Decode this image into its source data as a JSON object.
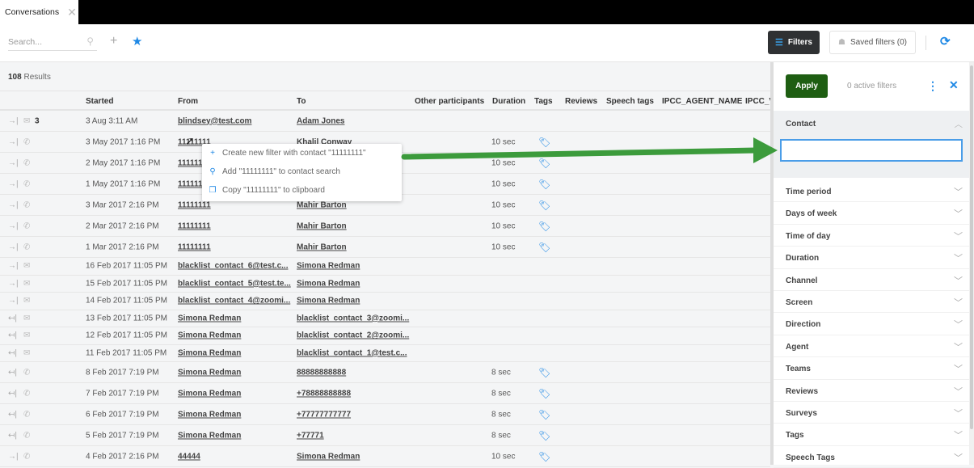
{
  "tab": {
    "title": "Conversations"
  },
  "toolbar": {
    "search_placeholder": "Search...",
    "filters_label": "Filters",
    "saved_filters_label": "Saved filters (0)"
  },
  "results": {
    "count": "108",
    "label": "Results"
  },
  "columns": [
    "Started",
    "From",
    "To",
    "Other participants",
    "Duration",
    "Tags",
    "Reviews",
    "Speech tags",
    "IPCC_AGENT_NAME",
    "IPCC_V"
  ],
  "rows": [
    {
      "dir": "in",
      "channel": "email",
      "count": "3",
      "started": "3 Aug 3:11 AM",
      "from": "blindsey@test.com",
      "to": "Adam Jones",
      "duration": "",
      "tag": false,
      "size": "tall"
    },
    {
      "dir": "in",
      "channel": "phone",
      "count": "",
      "started": "3 May 2017 1:16 PM",
      "from": "11111111",
      "to": "Khalil Conway",
      "duration": "10 sec",
      "tag": true,
      "size": "tall"
    },
    {
      "dir": "in",
      "channel": "phone",
      "count": "",
      "started": "2 May 2017 1:16 PM",
      "from": "11111111",
      "to": "",
      "duration": "10 sec",
      "tag": true,
      "size": "tall"
    },
    {
      "dir": "in",
      "channel": "phone",
      "count": "",
      "started": "1 May 2017 1:16 PM",
      "from": "11111111",
      "to": "",
      "duration": "10 sec",
      "tag": true,
      "size": "tall"
    },
    {
      "dir": "in",
      "channel": "phone",
      "count": "",
      "started": "3 Mar 2017 2:16 PM",
      "from": "11111111",
      "to": "Mahir Barton",
      "duration": "10 sec",
      "tag": true,
      "size": "tall"
    },
    {
      "dir": "in",
      "channel": "phone",
      "count": "",
      "started": "2 Mar 2017 2:16 PM",
      "from": "11111111",
      "to": "Mahir Barton",
      "duration": "10 sec",
      "tag": true,
      "size": "tall"
    },
    {
      "dir": "in",
      "channel": "phone",
      "count": "",
      "started": "1 Mar 2017 2:16 PM",
      "from": "11111111",
      "to": "Mahir Barton",
      "duration": "10 sec",
      "tag": true,
      "size": "tall"
    },
    {
      "dir": "in",
      "channel": "email",
      "count": "",
      "started": "16 Feb 2017 11:05 PM",
      "from": "blacklist_contact_6@test.c...",
      "to": "Simona Redman",
      "duration": "",
      "tag": false,
      "size": "short"
    },
    {
      "dir": "in",
      "channel": "email",
      "count": "",
      "started": "15 Feb 2017 11:05 PM",
      "from": "blacklist_contact_5@test.te...",
      "to": "Simona Redman",
      "duration": "",
      "tag": false,
      "size": "short"
    },
    {
      "dir": "in",
      "channel": "email",
      "count": "",
      "started": "14 Feb 2017 11:05 PM",
      "from": "blacklist_contact_4@zoomi...",
      "to": "Simona Redman",
      "duration": "",
      "tag": false,
      "size": "short"
    },
    {
      "dir": "out",
      "channel": "email",
      "count": "",
      "started": "13 Feb 2017 11:05 PM",
      "from": "Simona Redman",
      "to": "blacklist_contact_3@zoomi...",
      "duration": "",
      "tag": false,
      "size": "short"
    },
    {
      "dir": "out",
      "channel": "email",
      "count": "",
      "started": "12 Feb 2017 11:05 PM",
      "from": "Simona Redman",
      "to": "blacklist_contact_2@zoomi...",
      "duration": "",
      "tag": false,
      "size": "short"
    },
    {
      "dir": "out",
      "channel": "email",
      "count": "",
      "started": "11 Feb 2017 11:05 PM",
      "from": "Simona Redman",
      "to": "blacklist_contact_1@test.c...",
      "duration": "",
      "tag": false,
      "size": "short"
    },
    {
      "dir": "out",
      "channel": "phone",
      "count": "",
      "started": "8 Feb 2017 7:19 PM",
      "from": "Simona Redman",
      "to": "88888888888",
      "duration": "8 sec",
      "tag": true,
      "size": "tall"
    },
    {
      "dir": "out",
      "channel": "phone",
      "count": "",
      "started": "7 Feb 2017 7:19 PM",
      "from": "Simona Redman",
      "to": "+78888888888",
      "duration": "8 sec",
      "tag": true,
      "size": "tall"
    },
    {
      "dir": "out",
      "channel": "phone",
      "count": "",
      "started": "6 Feb 2017 7:19 PM",
      "from": "Simona Redman",
      "to": "+77777777777",
      "duration": "8 sec",
      "tag": true,
      "size": "tall"
    },
    {
      "dir": "out",
      "channel": "phone",
      "count": "",
      "started": "5 Feb 2017 7:19 PM",
      "from": "Simona Redman",
      "to": "+77771",
      "duration": "8 sec",
      "tag": true,
      "size": "tall"
    },
    {
      "dir": "in",
      "channel": "phone",
      "count": "",
      "started": "4 Feb 2017 2:16 PM",
      "from": "44444",
      "to": "Simona Redman",
      "duration": "10 sec",
      "tag": true,
      "size": "tall"
    }
  ],
  "context_menu": [
    "Create new filter with contact \"11111111\"",
    "Add \"11111111\" to contact search",
    "Copy \"11111111\" to clipboard"
  ],
  "panel": {
    "apply_label": "Apply",
    "active_filters": "0 active filters",
    "contact_label": "Contact",
    "contact_value": "",
    "filters": [
      "Time period",
      "Days of week",
      "Time of day",
      "Duration",
      "Channel",
      "Screen",
      "Direction",
      "Agent",
      "Teams",
      "Reviews",
      "Surveys",
      "Tags",
      "Speech Tags"
    ]
  },
  "colors": {
    "accent": "#1e88e5",
    "apply": "#1e5e12",
    "arrow": "#3c9b3c"
  }
}
